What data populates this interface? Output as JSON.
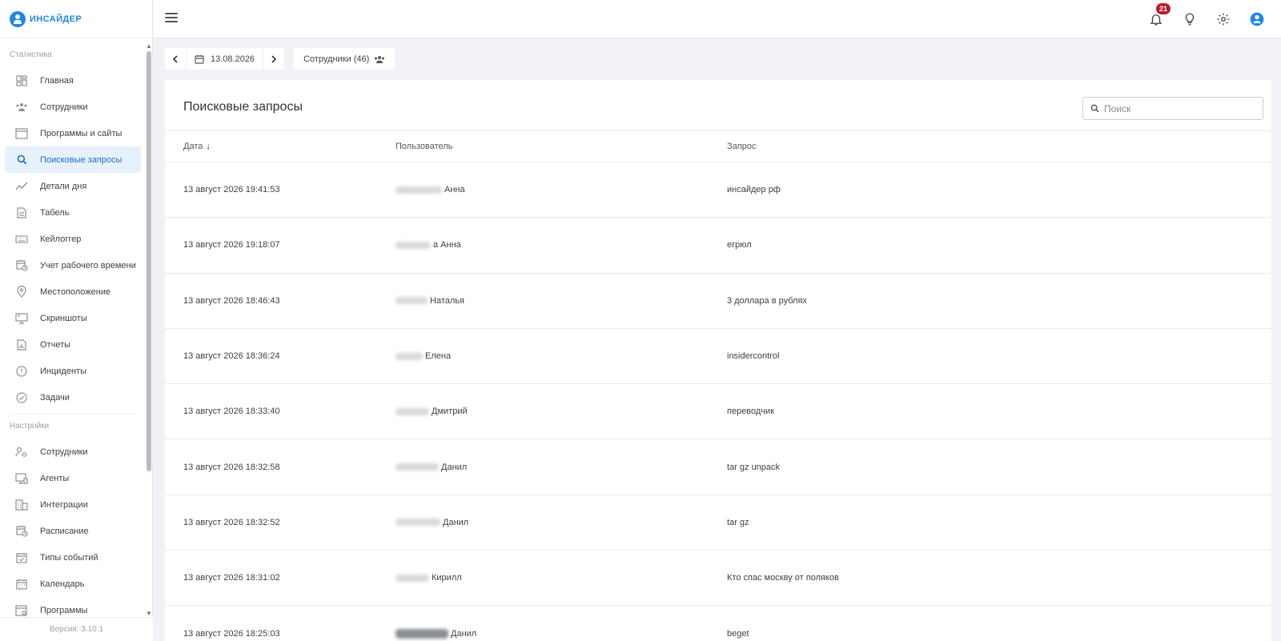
{
  "brand": {
    "name": "ИНСАЙДЕР"
  },
  "sidebar": {
    "stats_title": "Статистика",
    "stats_items": [
      {
        "label": "Главная",
        "icon": "dashboard-icon",
        "active": false
      },
      {
        "label": "Сотрудники",
        "icon": "users-icon",
        "active": false
      },
      {
        "label": "Программы и сайты",
        "icon": "window-icon",
        "active": false
      },
      {
        "label": "Поисковые запросы",
        "icon": "search-icon",
        "active": true
      },
      {
        "label": "Детали дня",
        "icon": "trend-icon",
        "active": false
      },
      {
        "label": "Табель",
        "icon": "document-icon",
        "active": false
      },
      {
        "label": "Кейлоггер",
        "icon": "keyboard-icon",
        "active": false
      },
      {
        "label": "Учет рабочего времени",
        "icon": "calendar-clock-icon",
        "active": false
      },
      {
        "label": "Местоположение",
        "icon": "location-pin-icon",
        "active": false
      },
      {
        "label": "Скриншоты",
        "icon": "screenshot-icon",
        "active": false
      },
      {
        "label": "Отчеты",
        "icon": "report-icon",
        "active": false
      },
      {
        "label": "Инциденты",
        "icon": "alert-circle-icon",
        "active": false
      },
      {
        "label": "Задачи",
        "icon": "check-circle-icon",
        "active": false
      }
    ],
    "settings_title": "Настройки",
    "settings_items": [
      {
        "label": "Сотрудники",
        "icon": "user-settings-icon"
      },
      {
        "label": "Агенты",
        "icon": "monitor-icon"
      },
      {
        "label": "Интеграции",
        "icon": "building-icon"
      },
      {
        "label": "Расписание",
        "icon": "calendar-clock-icon"
      },
      {
        "label": "Типы событий",
        "icon": "calendar-check-icon"
      },
      {
        "label": "Календарь",
        "icon": "calendar-icon"
      },
      {
        "label": "Программы",
        "icon": "app-window-icon"
      }
    ],
    "version": "Версия: 3.10.1"
  },
  "topbar": {
    "notifications_count": "21"
  },
  "toolbar": {
    "date": "13.08.2026",
    "employees_label": "Сотрудники (46)"
  },
  "card": {
    "title": "Поисковые запросы",
    "search_placeholder": "Поиск"
  },
  "table": {
    "columns": {
      "date": "Дата",
      "user": "Пользователь",
      "query": "Запрос"
    },
    "rows": [
      {
        "date": "13 август 2026 19:41:53",
        "user": "Анна",
        "query": "инсайдер рф"
      },
      {
        "date": "13 август 2026 19:18:07",
        "user": "а Анна",
        "query": "егрюл"
      },
      {
        "date": "13 август 2026 18:46:43",
        "user": "Наталья",
        "query": "3 доллара в рублях"
      },
      {
        "date": "13 август 2026 18:36:24",
        "user": "Елена",
        "query": "insidercontrol"
      },
      {
        "date": "13 август 2026 18:33:40",
        "user": "Дмитрий",
        "query": "переводчик"
      },
      {
        "date": "13 август 2026 18:32:58",
        "user": "Данил",
        "query": "tar gz unpack"
      },
      {
        "date": "13 август 2026 18:32:52",
        "user": "Данил",
        "query": "tar gz"
      },
      {
        "date": "13 август 2026 18:31:02",
        "user": "Кирилл",
        "query": "Кто спас москву от поляков"
      },
      {
        "date": "13 август 2026 18:25:03",
        "user": "Данил",
        "query": "beget"
      }
    ]
  }
}
